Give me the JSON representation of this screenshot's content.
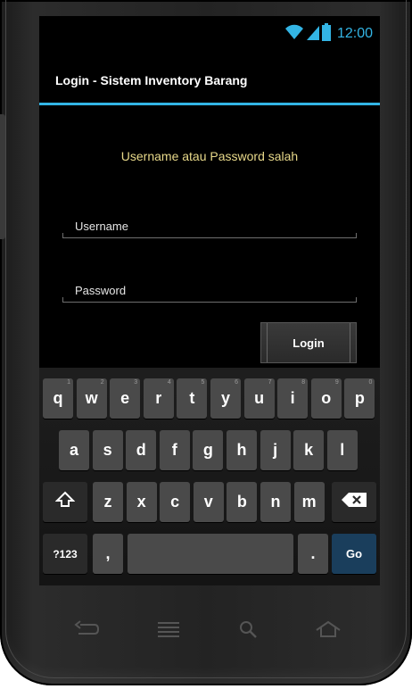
{
  "status_bar": {
    "time": "12:00",
    "accent": "#33b5e5"
  },
  "app": {
    "title": "Login - Sistem Inventory Barang",
    "error_message": "Username atau Password salah",
    "error_color": "#e8d98a",
    "username_placeholder": "Username",
    "password_placeholder": "Password",
    "login_label": "Login"
  },
  "keyboard": {
    "row1": [
      {
        "label": "q",
        "hint": "1"
      },
      {
        "label": "w",
        "hint": "2"
      },
      {
        "label": "e",
        "hint": "3"
      },
      {
        "label": "r",
        "hint": "4"
      },
      {
        "label": "t",
        "hint": "5"
      },
      {
        "label": "y",
        "hint": "6"
      },
      {
        "label": "u",
        "hint": "7"
      },
      {
        "label": "i",
        "hint": "8"
      },
      {
        "label": "o",
        "hint": "9"
      },
      {
        "label": "p",
        "hint": "0"
      }
    ],
    "row2": [
      "a",
      "s",
      "d",
      "f",
      "g",
      "h",
      "j",
      "k",
      "l"
    ],
    "row3": [
      "z",
      "x",
      "c",
      "v",
      "b",
      "n",
      "m"
    ],
    "symbols_label": "?123",
    "comma_label": ",",
    "period_label": ".",
    "go_label": "Go"
  },
  "icons": {
    "wifi": "wifi-icon",
    "signal": "signal-icon",
    "battery": "battery-icon",
    "back": "back-icon",
    "home": "home-icon",
    "menu": "menu-icon",
    "search": "search-icon",
    "shift": "shift-icon",
    "delete": "delete-icon"
  }
}
